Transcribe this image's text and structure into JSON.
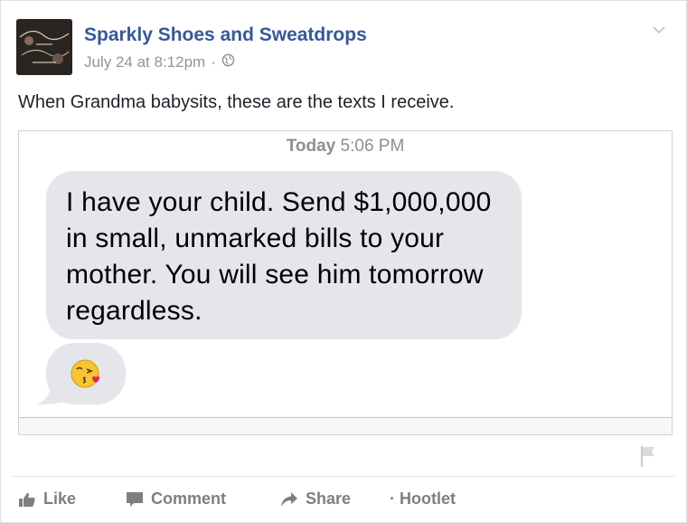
{
  "post": {
    "page_name": "Sparkly Shoes and Sweatdrops",
    "timestamp": "July 24 at 8:12pm",
    "separator": "·",
    "caption": "When Grandma babysits, these are the texts I receive."
  },
  "screenshot": {
    "time_day": "Today",
    "time_clock": "5:06 PM",
    "message": "I have your child. Send $1,000,000 in small, unmarked bills to your mother. You will see him tomorrow regardless.",
    "emoji": "kissing-face-with-heart-emoji",
    "bubble_color": "#e5e5ea"
  },
  "actions": {
    "like": "Like",
    "comment": "Comment",
    "share": "Share",
    "hootlet": "· Hootlet"
  },
  "colors": {
    "page_name": "#365899",
    "meta": "#90949c",
    "action_text": "#7f7f7f"
  },
  "icons": [
    "chevron-down-icon",
    "globe-icon",
    "thumbs-up-icon",
    "comment-icon",
    "share-icon",
    "flag-icon"
  ]
}
